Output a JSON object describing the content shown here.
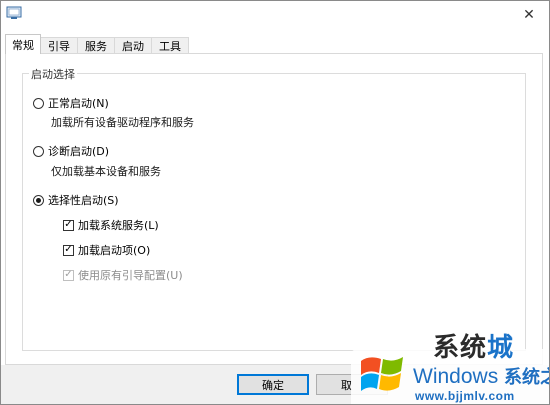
{
  "window": {
    "close_glyph": "✕"
  },
  "tabs": [
    {
      "label": "常规",
      "active": true
    },
    {
      "label": "引导",
      "active": false
    },
    {
      "label": "服务",
      "active": false
    },
    {
      "label": "启动",
      "active": false
    },
    {
      "label": "工具",
      "active": false
    }
  ],
  "startup_group": {
    "legend": "启动选择",
    "normal": {
      "label": "正常启动(N)",
      "checked": false,
      "desc": "加载所有设备驱动程序和服务"
    },
    "diagnostic": {
      "label": "诊断启动(D)",
      "checked": false,
      "desc": "仅加载基本设备和服务"
    },
    "selective": {
      "label": "选择性启动(S)",
      "checked": true
    },
    "options": [
      {
        "label": "加载系统服务(L)",
        "checked": true,
        "disabled": false
      },
      {
        "label": "加载启动项(O)",
        "checked": true,
        "disabled": false
      },
      {
        "label": "使用原有引导配置(U)",
        "checked": true,
        "disabled": true
      }
    ]
  },
  "buttons": {
    "ok": "确定",
    "cancel_partial": "取"
  },
  "watermark": {
    "big_text_1": "系统",
    "big_text_2": "城",
    "windows_text": "Windows",
    "windows_suffix": "系统之家",
    "site": "www.bjjmlv.com",
    "colors": {
      "red": "#f25022",
      "green": "#7fba00",
      "blue": "#00a4ef",
      "yellow": "#ffb900"
    }
  }
}
